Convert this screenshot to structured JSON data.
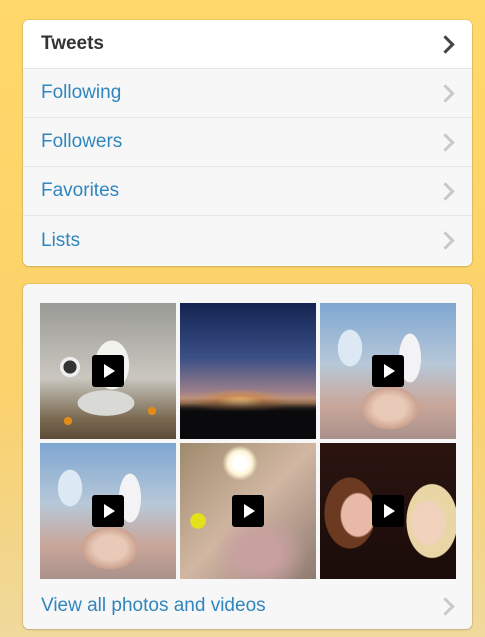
{
  "nav": {
    "items": [
      {
        "label": "Tweets",
        "active": true
      },
      {
        "label": "Following",
        "active": false
      },
      {
        "label": "Followers",
        "active": false
      },
      {
        "label": "Favorites",
        "active": false
      },
      {
        "label": "Lists",
        "active": false
      }
    ]
  },
  "media": {
    "thumbnails": [
      {
        "type": "video"
      },
      {
        "type": "photo"
      },
      {
        "type": "video"
      },
      {
        "type": "video"
      },
      {
        "type": "video"
      },
      {
        "type": "video"
      }
    ],
    "view_all_label": "View all photos and videos"
  },
  "colors": {
    "link": "#2f86be",
    "active_text": "#333333",
    "background_top": "#ffd96b",
    "background_bottom": "#efd99c"
  }
}
